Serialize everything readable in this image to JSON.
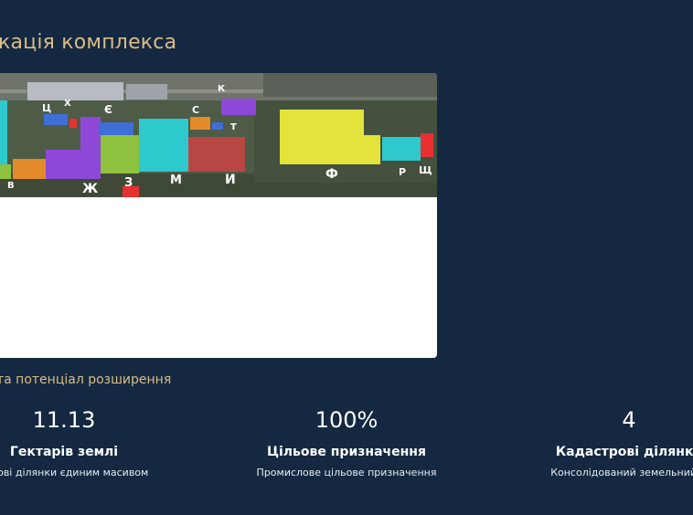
{
  "section_title": "кація комплекса",
  "map": {
    "labels": [
      "Ц",
      "Х",
      "Є",
      "К",
      "С",
      "Т",
      "В",
      "Ж",
      "З",
      "М",
      "И",
      "Ф",
      "Р",
      "Щ"
    ],
    "colors": {
      "yellow": "#e3e33b",
      "purple": "#8e48d8",
      "cyan": "#2ec9cc",
      "green": "#8fc23e",
      "red": "#b84744",
      "orange": "#e38a2a",
      "blue": "#3f6fd6",
      "bright_red": "#e83030"
    }
  },
  "subtitle": "та потенціал розширення",
  "stats": [
    {
      "value": "11.13",
      "label": "Гектарів землі",
      "desc": "строві ділянки єдиним масивом"
    },
    {
      "value": "100%",
      "label": "Цільове призначення",
      "desc": "Промислове цільове призначення"
    },
    {
      "value": "4",
      "label": "Кадастрові ділянки",
      "desc": "Консолідований земельний м"
    }
  ]
}
